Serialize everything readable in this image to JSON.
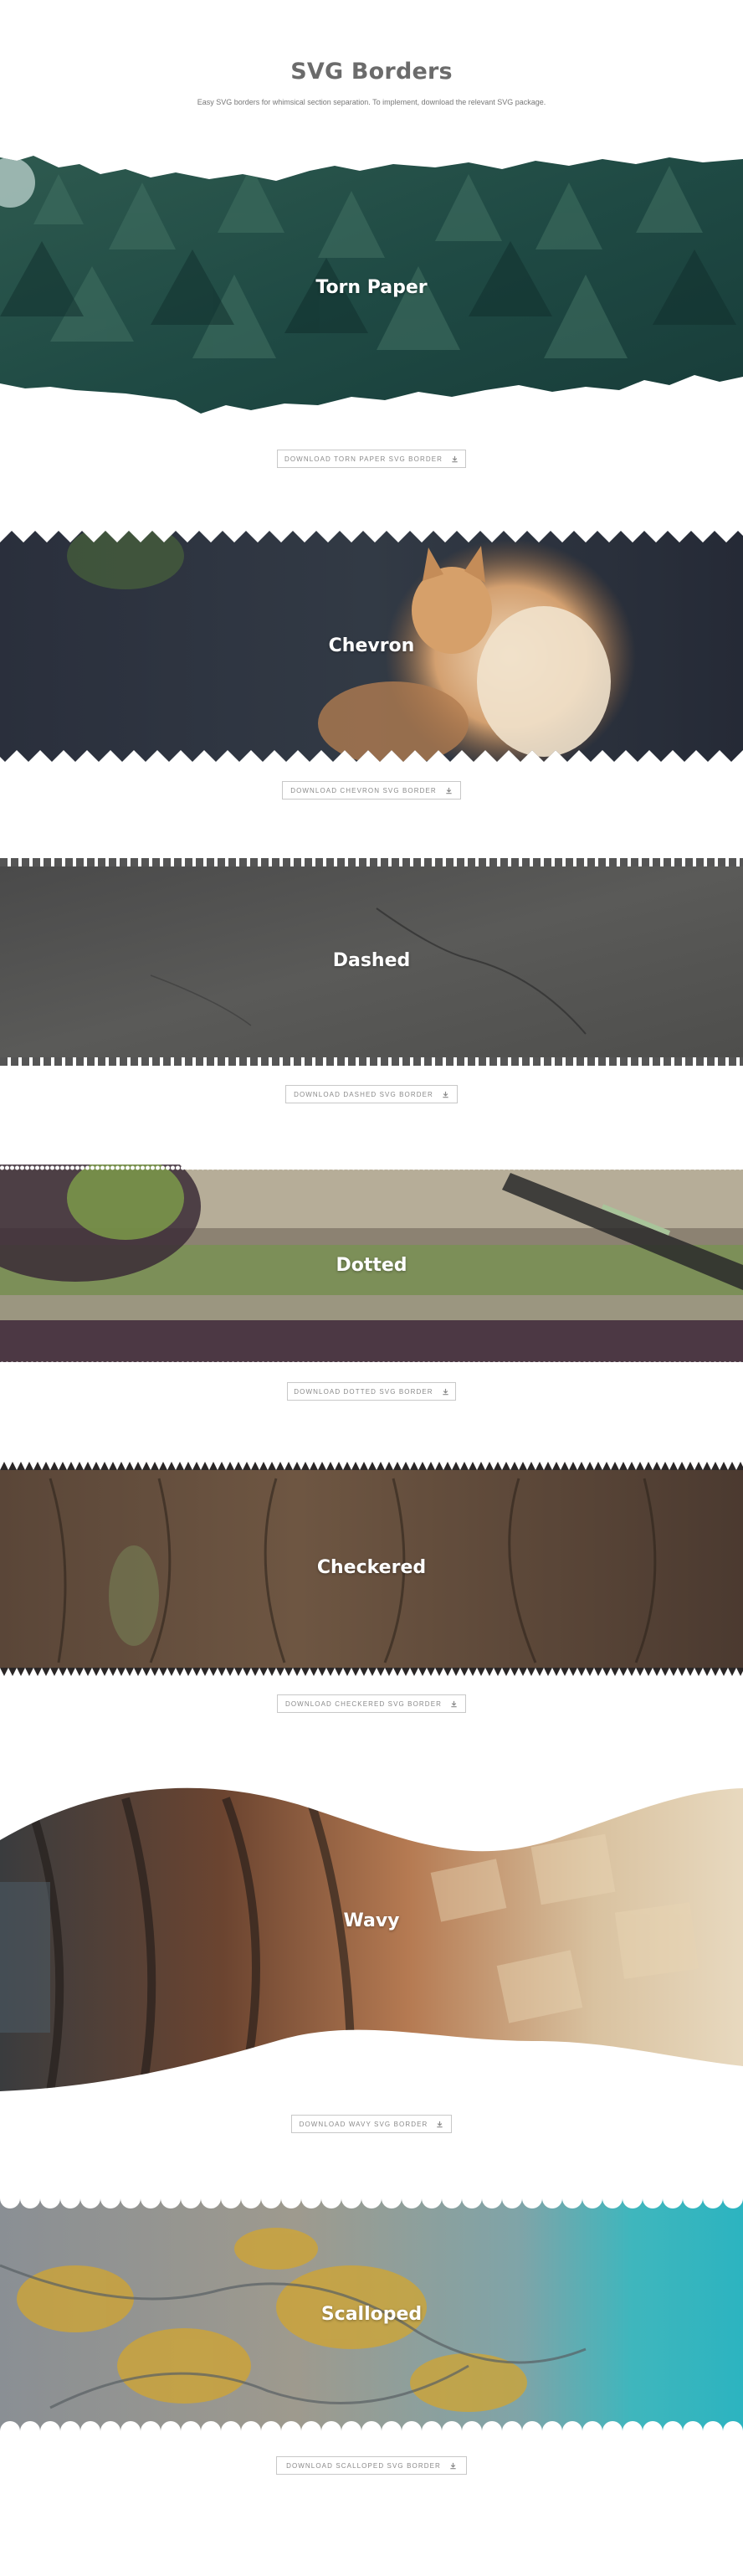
{
  "header": {
    "title": "SVG Borders",
    "subtitle": "Easy SVG borders for whimsical section separation. To implement, download the relevant SVG package."
  },
  "sections": [
    {
      "label": "Torn Paper",
      "button": "DOWNLOAD TORN PAPER SVG BORDER",
      "image": "pine-forest"
    },
    {
      "label": "Chevron",
      "button": "DOWNLOAD CHEVRON SVG BORDER",
      "image": "cat"
    },
    {
      "label": "Dashed",
      "button": "DOWNLOAD DASHED SVG BORDER",
      "image": "stone"
    },
    {
      "label": "Dotted",
      "button": "DOWNLOAD DOTTED SVG BORDER",
      "image": "fabric-and-pen"
    },
    {
      "label": "Checkered",
      "button": "DOWNLOAD CHECKERED SVG BORDER",
      "image": "tree-bark"
    },
    {
      "label": "Wavy",
      "button": "DOWNLOAD WAVY SVG BORDER",
      "image": "metal-sheets"
    },
    {
      "label": "Scalloped",
      "button": "DOWNLOAD SCALLOPED SVG BORDER",
      "image": "aerial-river"
    }
  ],
  "icons": {
    "download": "download-icon"
  },
  "colors": {
    "title": "#6b6b6b",
    "button_border": "#c8c8c8",
    "button_text": "#8a8a8a",
    "label": "#ffffff"
  }
}
